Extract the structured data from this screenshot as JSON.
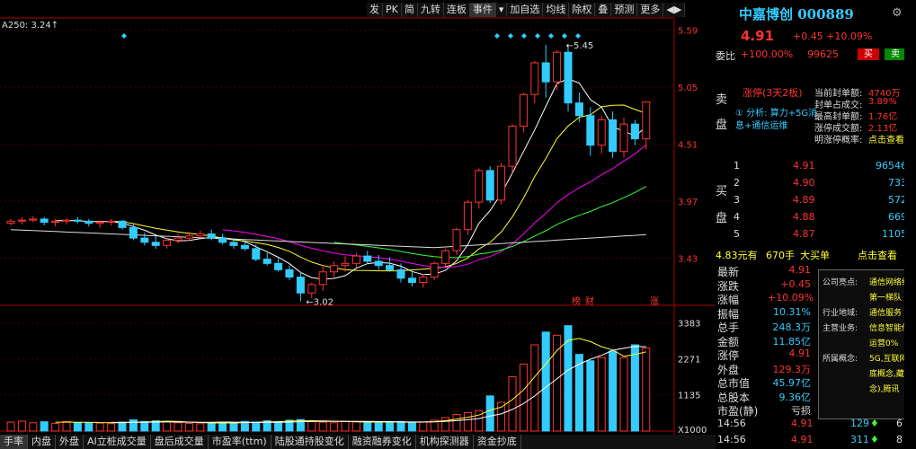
{
  "indicator_label": "A250: 3.24↑",
  "toolbar": [
    "发",
    "PK",
    "简",
    "九转",
    "连板",
    "事件",
    "▾",
    "加自选",
    "均线",
    "除权",
    "叠",
    "预测",
    "更多",
    "◀▶"
  ],
  "stock": {
    "name": "中嘉博创",
    "code": "000889",
    "price": "4.91",
    "change": "+0.45",
    "pct": "+10.09%"
  },
  "weibi": {
    "label": "委比",
    "value": "+100.00%",
    "diff": "99625",
    "sell_btn": "买",
    "buy_btn": "卖"
  },
  "sell_side": {
    "label1": "卖",
    "label2": "盘",
    "status": "涨停(3天2板)",
    "analysis_a": "① 分析: 算力+5G消",
    "analysis_b": "息+通信运维",
    "stats": [
      {
        "k": "当前封单额:",
        "v": "4740万"
      },
      {
        "k": "封单占成交:",
        "v": "3.89%"
      },
      {
        "k": "最高封单额:",
        "v": "1.76亿"
      },
      {
        "k": "涨停成交额:",
        "v": "2.13亿"
      },
      {
        "k": "明涨停概率:",
        "v": "点击查看"
      }
    ]
  },
  "buy_side": {
    "label1": "买",
    "label2": "盘",
    "levels": [
      {
        "n": "1",
        "p": "4.91",
        "v": "96546"
      },
      {
        "n": "2",
        "p": "4.90",
        "v": "733"
      },
      {
        "n": "3",
        "p": "4.89",
        "v": "572"
      },
      {
        "n": "4",
        "p": "4.88",
        "v": "669"
      },
      {
        "n": "5",
        "p": "4.87",
        "v": "1105"
      }
    ]
  },
  "big_order": {
    "amount": "4.83元有",
    "vol": "670手",
    "label": "大买单",
    "link": "点击查看"
  },
  "quote_list": [
    {
      "k": "最新",
      "v": "4.91",
      "c": "red"
    },
    {
      "k": "涨跌",
      "v": "+0.45",
      "c": "red"
    },
    {
      "k": "涨幅",
      "v": "+10.09%",
      "c": "red"
    },
    {
      "k": "振幅",
      "v": "10.31%",
      "c": "cyan"
    },
    {
      "k": "总手",
      "v": "248.3万",
      "c": "cyan"
    },
    {
      "k": "金额",
      "v": "11.85亿",
      "c": "cyan"
    },
    {
      "k": "涨停",
      "v": "4.91",
      "c": "red"
    },
    {
      "k": "外盘",
      "v": "129.3万",
      "c": "red"
    },
    {
      "k": "总市值",
      "v": "45.97亿",
      "c": "cyan"
    },
    {
      "k": "总股本",
      "v": "9.36亿",
      "c": "cyan"
    },
    {
      "k": "市盈(静)",
      "v": "亏损",
      "c": "lbl"
    }
  ],
  "trades": [
    {
      "t": "14:56",
      "p": "4.91",
      "v": "129",
      "a": "♦",
      "n": "6"
    },
    {
      "t": "14:56",
      "p": "4.91",
      "v": "311",
      "a": "♦",
      "n": "8"
    }
  ],
  "popup": {
    "rows": [
      {
        "k": "公司亮点:",
        "v": "通信网络维"
      },
      {
        "k": "",
        "v": "第一梯队"
      },
      {
        "k": "行业地域:",
        "v": "通信服务"
      },
      {
        "k": "主营业务:",
        "v": "信息智能传"
      },
      {
        "k": "",
        "v": "运营0%"
      },
      {
        "k": "所属概念:",
        "v": "5G,互联网"
      },
      {
        "k": "",
        "v": "底概念,藏"
      },
      {
        "k": "",
        "v": "念),腾讯"
      }
    ]
  },
  "bottom_tabs": [
    "手率",
    "内盘",
    "外盘",
    "AI立桩成交量",
    "盘后成交量",
    "市盈率(ttm)",
    "陆股通持股变化",
    "融资融券变化",
    "机构探测器",
    "资金抄底"
  ],
  "chart_data": {
    "type": "candlestick",
    "y_ticks": [
      "5.59",
      "5.05",
      "4.51",
      "3.97",
      "3.43"
    ],
    "vol_ticks": [
      "3383",
      "2271",
      "1135",
      "X1000"
    ],
    "annotations": {
      "high": "5.45",
      "low": "3.02",
      "tags": [
        "榜",
        "财",
        "涨"
      ]
    },
    "candles": [
      [
        3.76,
        3.8,
        3.74,
        3.78
      ],
      [
        3.78,
        3.82,
        3.75,
        3.79
      ],
      [
        3.79,
        3.83,
        3.77,
        3.8
      ],
      [
        3.8,
        3.82,
        3.74,
        3.77
      ],
      [
        3.77,
        3.8,
        3.73,
        3.78
      ],
      [
        3.78,
        3.81,
        3.75,
        3.79
      ],
      [
        3.79,
        3.82,
        3.76,
        3.78
      ],
      [
        3.78,
        3.8,
        3.73,
        3.76
      ],
      [
        3.76,
        3.79,
        3.72,
        3.77
      ],
      [
        3.77,
        3.8,
        3.74,
        3.78
      ],
      [
        3.78,
        3.79,
        3.7,
        3.72
      ],
      [
        3.72,
        3.75,
        3.6,
        3.62
      ],
      [
        3.62,
        3.67,
        3.55,
        3.58
      ],
      [
        3.58,
        3.64,
        3.52,
        3.55
      ],
      [
        3.55,
        3.62,
        3.52,
        3.6
      ],
      [
        3.6,
        3.66,
        3.57,
        3.62
      ],
      [
        3.62,
        3.68,
        3.59,
        3.64
      ],
      [
        3.64,
        3.69,
        3.62,
        3.66
      ],
      [
        3.66,
        3.7,
        3.6,
        3.62
      ],
      [
        3.62,
        3.66,
        3.56,
        3.58
      ],
      [
        3.58,
        3.62,
        3.52,
        3.55
      ],
      [
        3.55,
        3.6,
        3.5,
        3.52
      ],
      [
        3.52,
        3.56,
        3.4,
        3.42
      ],
      [
        3.42,
        3.48,
        3.36,
        3.38
      ],
      [
        3.38,
        3.43,
        3.3,
        3.32
      ],
      [
        3.32,
        3.36,
        3.22,
        3.25
      ],
      [
        3.25,
        3.3,
        3.02,
        3.1
      ],
      [
        3.1,
        3.2,
        3.05,
        3.18
      ],
      [
        3.18,
        3.35,
        3.12,
        3.3
      ],
      [
        3.3,
        3.4,
        3.25,
        3.36
      ],
      [
        3.36,
        3.45,
        3.3,
        3.38
      ],
      [
        3.38,
        3.48,
        3.34,
        3.45
      ],
      [
        3.45,
        3.5,
        3.38,
        3.4
      ],
      [
        3.4,
        3.46,
        3.32,
        3.36
      ],
      [
        3.36,
        3.44,
        3.3,
        3.32
      ],
      [
        3.32,
        3.38,
        3.2,
        3.24
      ],
      [
        3.24,
        3.3,
        3.16,
        3.2
      ],
      [
        3.2,
        3.28,
        3.15,
        3.25
      ],
      [
        3.25,
        3.4,
        3.22,
        3.38
      ],
      [
        3.38,
        3.52,
        3.35,
        3.5
      ],
      [
        3.5,
        3.72,
        3.46,
        3.7
      ],
      [
        3.7,
        3.98,
        3.65,
        3.96
      ],
      [
        3.96,
        4.28,
        3.9,
        4.26
      ],
      [
        4.26,
        4.3,
        3.95,
        3.98
      ],
      [
        3.98,
        4.33,
        3.94,
        4.3
      ],
      [
        4.3,
        4.7,
        4.24,
        4.68
      ],
      [
        4.68,
        5.0,
        4.62,
        4.98
      ],
      [
        4.98,
        5.3,
        4.9,
        5.28
      ],
      [
        5.28,
        5.45,
        4.95,
        5.1
      ],
      [
        5.1,
        5.4,
        5.02,
        5.38
      ],
      [
        5.38,
        5.45,
        4.82,
        4.9
      ],
      [
        4.9,
        5.0,
        4.72,
        4.78
      ],
      [
        4.78,
        4.86,
        4.4,
        4.5
      ],
      [
        4.5,
        4.78,
        4.42,
        4.74
      ],
      [
        4.74,
        4.82,
        4.38,
        4.44
      ],
      [
        4.44,
        4.76,
        4.38,
        4.7
      ],
      [
        4.7,
        4.74,
        4.5,
        4.56
      ],
      [
        4.56,
        4.91,
        4.46,
        4.91
      ]
    ],
    "volumes": [
      280,
      310,
      260,
      290,
      240,
      300,
      270,
      260,
      250,
      230,
      280,
      350,
      300,
      320,
      290,
      260,
      240,
      230,
      250,
      280,
      260,
      300,
      280,
      320,
      300,
      340,
      360,
      300,
      280,
      260,
      310,
      300,
      260,
      280,
      260,
      300,
      280,
      290,
      340,
      420,
      520,
      580,
      640,
      1100,
      900,
      1700,
      2100,
      2700,
      3100,
      3000,
      3300,
      2400,
      2200,
      2300,
      2500,
      2300,
      2700,
      2600
    ],
    "vol_max": 3600
  }
}
